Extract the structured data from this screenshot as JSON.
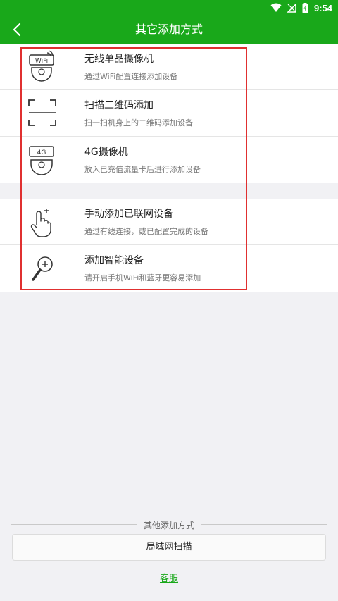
{
  "status_bar": {
    "time": "9:54"
  },
  "header": {
    "title": "其它添加方式"
  },
  "options": [
    {
      "title": "无线单品摄像机",
      "subtitle": "通过WiFi配置连接添加设备",
      "icon": "wifi-camera-icon",
      "icon_text": "WiFi"
    },
    {
      "title": "扫描二维码添加",
      "subtitle": "扫一扫机身上的二维码添加设备",
      "icon": "qr-scan-icon"
    },
    {
      "title": "4G摄像机",
      "subtitle": "放入已充值流量卡后进行添加设备",
      "icon": "4g-camera-icon",
      "icon_text": "4G"
    },
    {
      "title": "手动添加已联网设备",
      "subtitle": "通过有线连接，或已配置完成的设备",
      "icon": "hand-tap-icon"
    },
    {
      "title": "添加智能设备",
      "subtitle": "请开启手机WiFi和蓝牙更容易添加",
      "icon": "magnifier-plus-icon"
    }
  ],
  "footer": {
    "other_methods_label": "其他添加方式",
    "lan_scan_label": "局域网扫描",
    "support_label": "客服"
  },
  "colors": {
    "brand": "#19a81a",
    "highlight": "#e03030"
  }
}
